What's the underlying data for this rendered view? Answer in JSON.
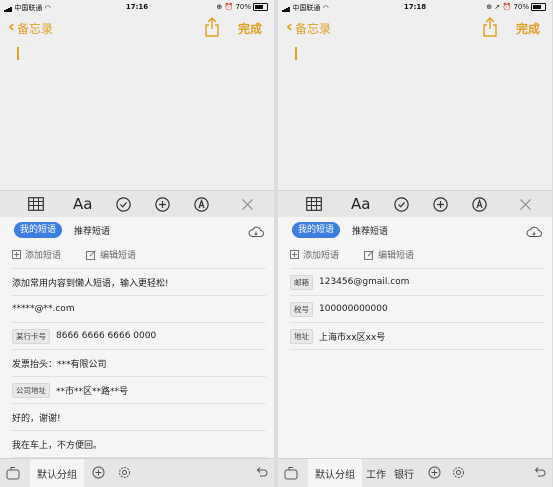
{
  "colors": {
    "accent": "#e0a022",
    "pill": "#3d7fe0"
  },
  "screens": {
    "left": {
      "status": {
        "carrier": "中国联通",
        "time": "17:16",
        "battery_text": "70%",
        "battery_level": 0.7
      },
      "nav": {
        "back_label": "备忘录",
        "done_label": "完成"
      },
      "toolbar": {
        "text_format_label": "Aa"
      },
      "phrases": {
        "tab_mine": "我的短语",
        "tab_recommended": "推荐短语",
        "add_label": "添加短语",
        "edit_label": "编辑短语"
      },
      "rows": [
        {
          "tag": "",
          "text": "添加常用内容到懒人短语，输入更轻松!"
        },
        {
          "tag": "",
          "text": "*****@**.com"
        },
        {
          "tag": "某行卡号",
          "text": "8666 6666 6666 0000"
        },
        {
          "tag": "",
          "text": "发票抬头：***有限公司"
        },
        {
          "tag": "公司地址",
          "text": "**市**区**路**号"
        },
        {
          "tag": "",
          "text": "好的，谢谢!"
        },
        {
          "tag": "",
          "text": "我在车上，不方便回。"
        }
      ],
      "bottom": {
        "groups": [
          "默认分组"
        ]
      }
    },
    "right": {
      "status": {
        "carrier": "中国联通",
        "time": "17:18",
        "battery_text": "70%",
        "battery_level": 0.7
      },
      "nav": {
        "back_label": "备忘录",
        "done_label": "完成"
      },
      "toolbar": {
        "text_format_label": "Aa"
      },
      "phrases": {
        "tab_mine": "我的短语",
        "tab_recommended": "推荐短语",
        "add_label": "添加短语",
        "edit_label": "编辑短语"
      },
      "rows": [
        {
          "tag": "邮箱",
          "text": "123456@gmail.com"
        },
        {
          "tag": "税号",
          "text": "100000000000"
        },
        {
          "tag": "地址",
          "text": "上海市xx区xx号"
        }
      ],
      "bottom": {
        "groups": [
          "默认分组",
          "工作",
          "银行"
        ]
      }
    }
  }
}
